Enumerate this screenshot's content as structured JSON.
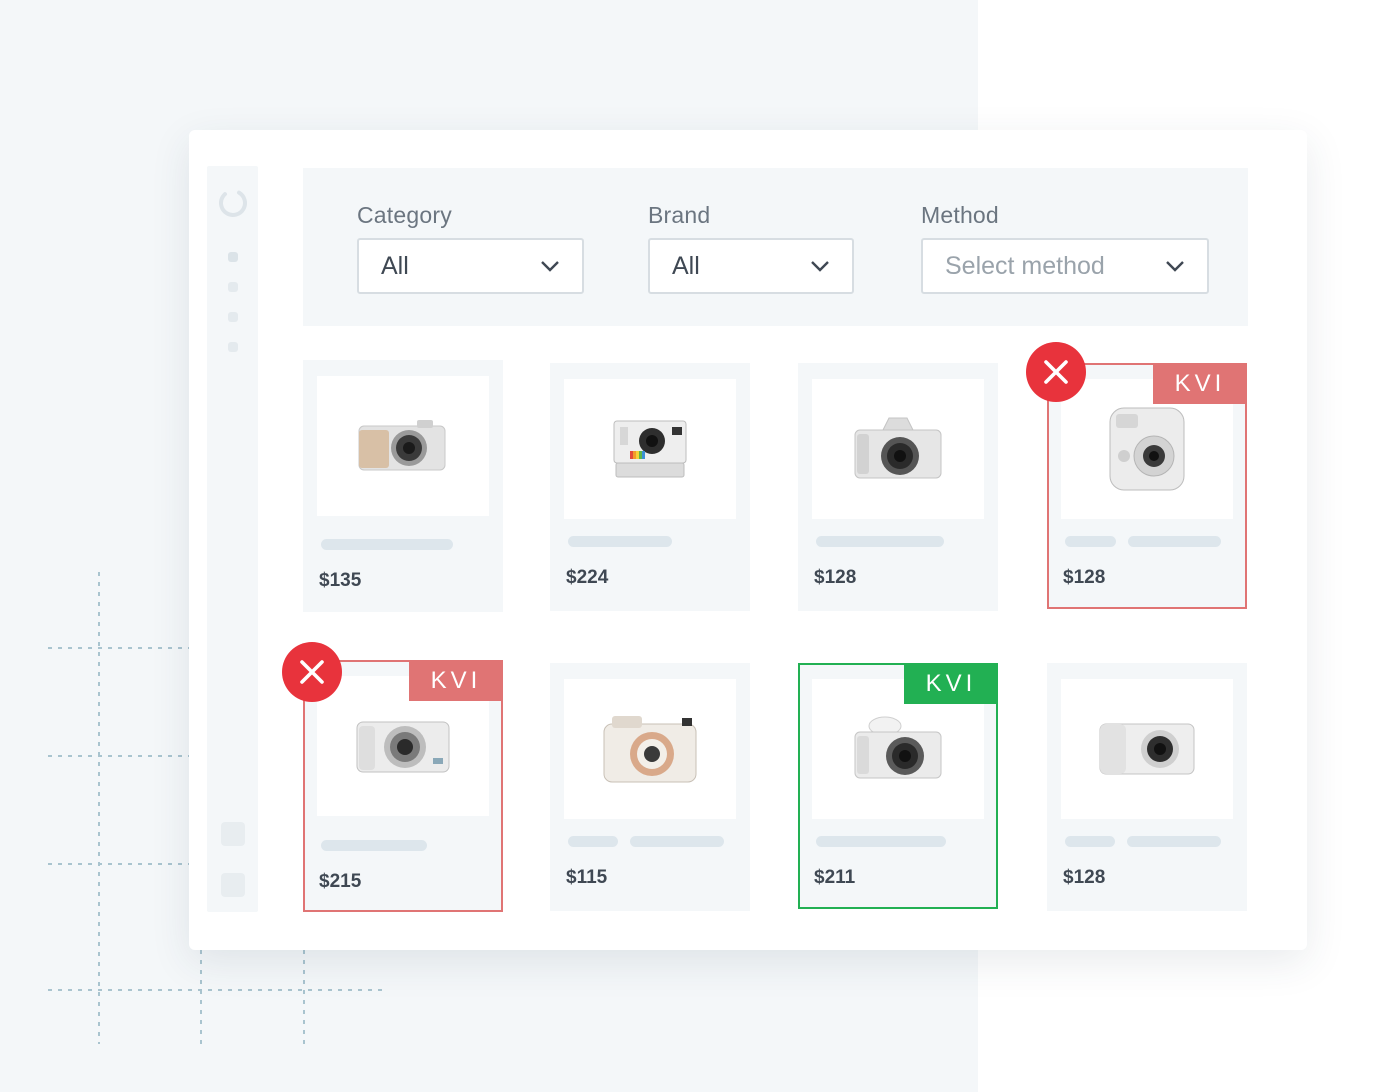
{
  "filters": {
    "category": {
      "label": "Category",
      "value": "All"
    },
    "brand": {
      "label": "Brand",
      "value": "All"
    },
    "method": {
      "label": "Method",
      "placeholder": "Select method"
    }
  },
  "products": [
    {
      "price": "$135",
      "camera": "mirrorless-tan-camera-icon",
      "kvi": null
    },
    {
      "price": "$224",
      "camera": "instant-polaroid-camera-icon",
      "kvi": null
    },
    {
      "price": "$128",
      "camera": "mirrorless-canon-camera-icon",
      "kvi": null
    },
    {
      "price": "$128",
      "camera": "instax-mini-camera-icon",
      "kvi": {
        "label": "KVI",
        "status": "rejected"
      }
    },
    {
      "price": "$215",
      "camera": "compact-camera-icon",
      "kvi": {
        "label": "KVI",
        "status": "rejected"
      }
    },
    {
      "price": "$115",
      "camera": "instax-wide-camera-icon",
      "kvi": null
    },
    {
      "price": "$211",
      "camera": "vlog-camera-icon",
      "kvi": {
        "label": "KVI",
        "status": "approved"
      }
    },
    {
      "price": "$128",
      "camera": "galaxy-camera-icon",
      "kvi": null
    }
  ],
  "colors": {
    "rejected": "#e07474",
    "approved": "#22b053",
    "remove_badge": "#e8333c"
  }
}
